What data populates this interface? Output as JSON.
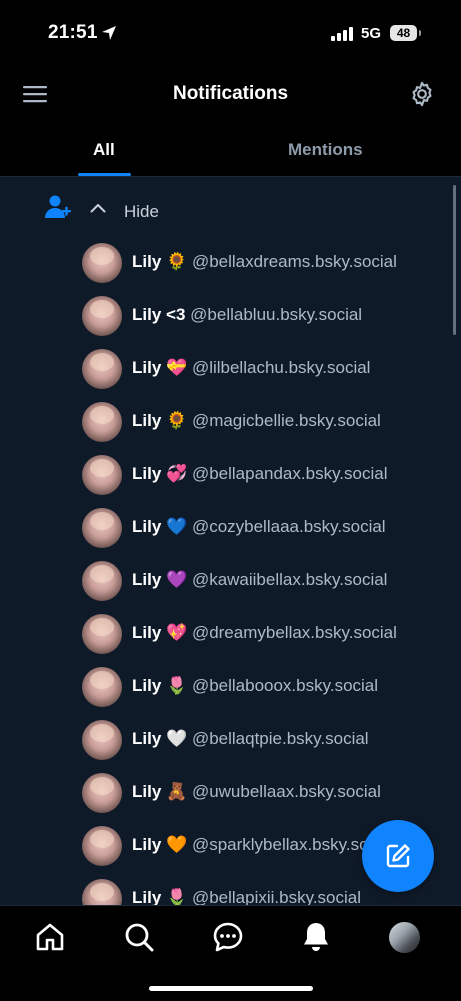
{
  "status_bar": {
    "time": "21:51",
    "network": "5G",
    "battery": "48"
  },
  "header": {
    "title": "Notifications"
  },
  "tabs": [
    {
      "label": "All"
    },
    {
      "label": "Mentions"
    }
  ],
  "group": {
    "toggle_label": "Hide"
  },
  "followers": [
    {
      "name": "Lily",
      "emoji": "🌻",
      "handle": "@bellaxdreams.bsky.social"
    },
    {
      "name": "Lily",
      "emoji": "<3",
      "handle": "@bellabluu.bsky.social"
    },
    {
      "name": "Lily",
      "emoji": "💝",
      "handle": "@lilbellachu.bsky.social"
    },
    {
      "name": "Lily",
      "emoji": "🌻",
      "handle": "@magicbellie.bsky.social"
    },
    {
      "name": "Lily",
      "emoji": "💞",
      "handle": "@bellapandax.bsky.social"
    },
    {
      "name": "Lily",
      "emoji": "💙",
      "handle": "@cozybellaaa.bsky.social"
    },
    {
      "name": "Lily",
      "emoji": "💜",
      "handle": "@kawaiibellax.bsky.social"
    },
    {
      "name": "Lily",
      "emoji": "💖",
      "handle": "@dreamybellax.bsky.social"
    },
    {
      "name": "Lily",
      "emoji": "🌷",
      "handle": "@bellabooox.bsky.social"
    },
    {
      "name": "Lily",
      "emoji": "🤍",
      "handle": "@bellaqtpie.bsky.social"
    },
    {
      "name": "Lily",
      "emoji": "🧸",
      "handle": "@uwubellaax.bsky.social"
    },
    {
      "name": "Lily",
      "emoji": "🧡",
      "handle": "@sparklybellax.bsky.social"
    },
    {
      "name": "Lily",
      "emoji": "🌷",
      "handle": "@bellapixii.bsky.social"
    }
  ],
  "icons": {
    "status": [
      "location-arrow-icon",
      "signal-icon",
      "battery-icon"
    ],
    "header": [
      "menu-icon",
      "settings-gear-icon"
    ],
    "group": [
      "follow-user-icon",
      "chevron-up-icon"
    ],
    "fab": "compose-icon",
    "nav": [
      "home-icon",
      "search-icon",
      "chat-icon",
      "bell-icon",
      "profile-avatar"
    ]
  },
  "colors": {
    "accent": "#1083fe",
    "background": "#000000",
    "content_background": "#0f1a29",
    "muted_text": "#aeb9c7"
  }
}
